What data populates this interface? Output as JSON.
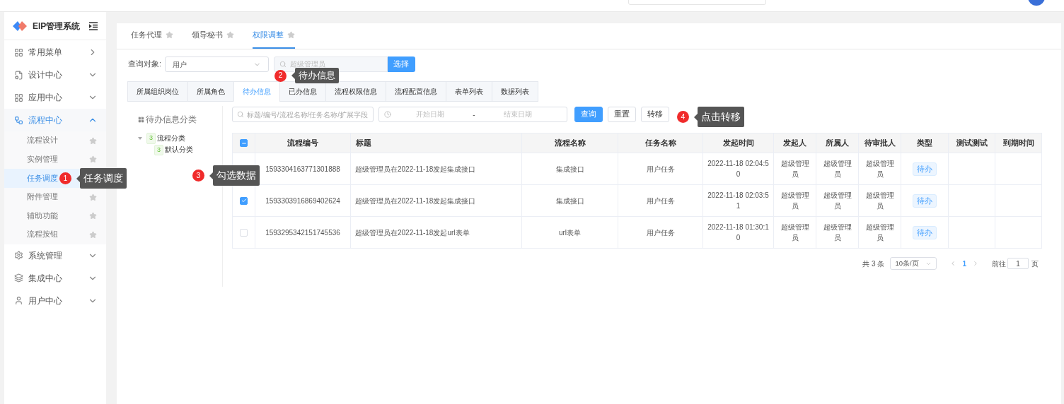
{
  "app": {
    "title": "EIP管理系统"
  },
  "sidebar": {
    "items": [
      {
        "label": "常用菜单",
        "kind": "link",
        "selected": false
      },
      {
        "label": "设计中心",
        "kind": "group",
        "expanded": false,
        "selected": false
      },
      {
        "label": "应用中心",
        "kind": "group",
        "expanded": false,
        "selected": false
      },
      {
        "label": "流程中心",
        "kind": "group",
        "expanded": true,
        "selected": true,
        "children": [
          {
            "label": "流程设计",
            "selected": false
          },
          {
            "label": "实例管理",
            "selected": false
          },
          {
            "label": "任务调度",
            "selected": true
          },
          {
            "label": "附件管理",
            "selected": false
          },
          {
            "label": "辅助功能",
            "selected": false
          },
          {
            "label": "流程按钮",
            "selected": false
          }
        ]
      },
      {
        "label": "系统管理",
        "kind": "group",
        "expanded": false,
        "selected": false
      },
      {
        "label": "集成中心",
        "kind": "group",
        "expanded": false,
        "selected": false
      },
      {
        "label": "用户中心",
        "kind": "group",
        "expanded": false,
        "selected": false
      }
    ]
  },
  "page_tabs": [
    {
      "label": "任务代理",
      "selected": false
    },
    {
      "label": "领导秘书",
      "selected": false
    },
    {
      "label": "权限调整",
      "selected": true
    }
  ],
  "query": {
    "label": "查询对象:",
    "select_value": "用户",
    "search_placeholder": "超级管理员",
    "button": "选择"
  },
  "sub_tabs": [
    {
      "label": "所属组织岗位",
      "selected": false
    },
    {
      "label": "所属角色",
      "selected": false
    },
    {
      "label": "待办信息",
      "selected": true
    },
    {
      "label": "已办信息",
      "selected": false
    },
    {
      "label": "流程权限信息",
      "selected": false
    },
    {
      "label": "流程配置信息",
      "selected": false
    },
    {
      "label": "表单列表",
      "selected": false
    },
    {
      "label": "数据列表",
      "selected": false
    }
  ],
  "tree": {
    "title": "待办信息分类",
    "nodes": [
      {
        "count": "3",
        "label": "流程分类",
        "expanded": true,
        "children": [
          {
            "count": "3",
            "label": "默认分类"
          }
        ]
      }
    ]
  },
  "filter": {
    "placeholder": "标题/编号/流程名称/任务名称/扩展字段",
    "start_placeholder": "开始日期",
    "separator": "-",
    "end_placeholder": "结束日期",
    "buttons": [
      {
        "label": "查询",
        "kind": "primary"
      },
      {
        "label": "重置",
        "kind": "default"
      },
      {
        "label": "转移",
        "kind": "default"
      }
    ]
  },
  "table": {
    "header_indeterminate": true,
    "columns": [
      "流程编号",
      "标题",
      "流程名称",
      "任务名称",
      "发起时间",
      "发起人",
      "所属人",
      "待审批人",
      "类型",
      "测试测试",
      "到期时间"
    ],
    "rows": [
      {
        "cells": [
          "1593304163771301888",
          "超级管理员在2022-11-18发起集成接口",
          "集成接口",
          "用户任务",
          "2022-11-18 02:04:50",
          "超级管理员",
          "超级管理员",
          "超级管理员",
          "待办"
        ]
      },
      {
        "checked": true,
        "cells": [
          "1593303916869402624",
          "超级管理员在2022-11-18发起集成接口",
          "集成接口",
          "用户任务",
          "2022-11-18 02:03:51",
          "超级管理员",
          "超级管理员",
          "超级管理员",
          "待办"
        ]
      },
      {
        "checked": false,
        "cells": [
          "1593295342151745536",
          "超级管理员在2022-11-18发起url表单",
          "url表单",
          "用户任务",
          "2022-11-18 01:30:10",
          "超级管理员",
          "超级管理员",
          "超级管理员",
          "待办"
        ]
      }
    ]
  },
  "pagination": {
    "total": "共 3 条",
    "page_size": "10条/页",
    "pages": [
      {
        "label": "1",
        "selected": true
      }
    ],
    "goto_label": "前往",
    "goto_value": "1",
    "goto_suffix": "页"
  },
  "callouts": [
    {
      "number": "1",
      "text": "任务调度"
    },
    {
      "number": "2",
      "text": "待办信息"
    },
    {
      "number": "3",
      "text": "勾选数据"
    },
    {
      "number": "4",
      "text": "点击转移"
    }
  ]
}
